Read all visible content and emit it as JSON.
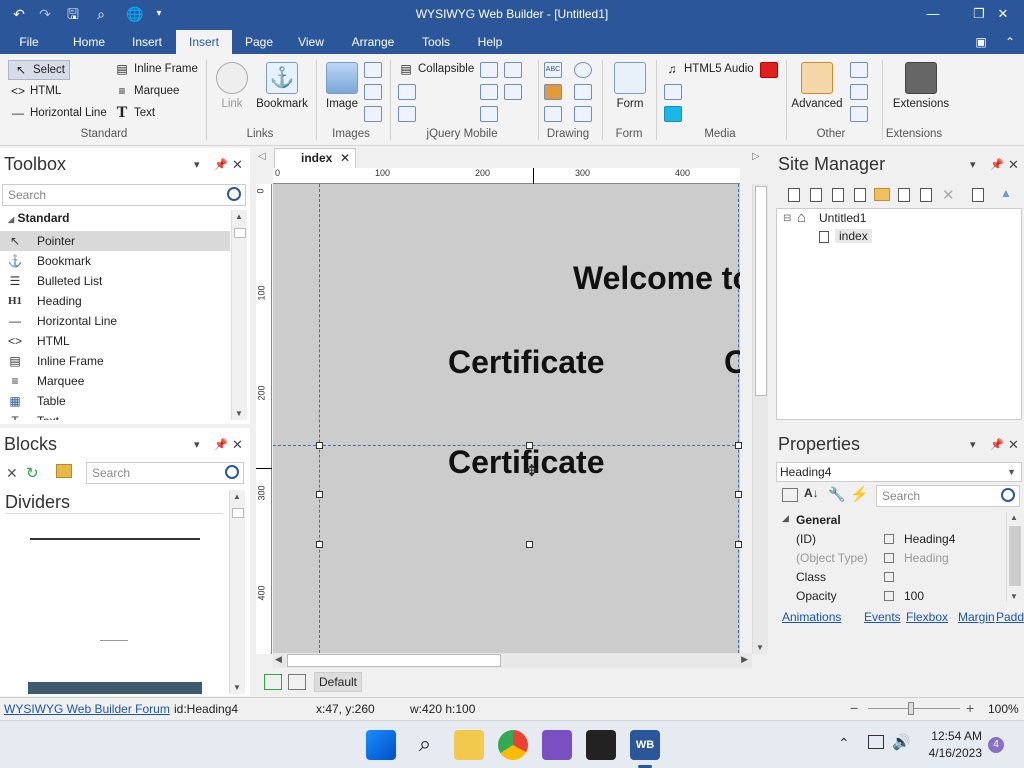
{
  "window": {
    "title": "WYSIWYG Web Builder - [Untitled1]",
    "minimize": "—",
    "restore": "❐",
    "close": "✕"
  },
  "menu_tabs": [
    "File",
    "Home",
    "Insert",
    "Insert",
    "Page",
    "View",
    "Arrange",
    "Tools",
    "Help"
  ],
  "active_tab_index": 3,
  "ribbon": {
    "standard": {
      "select": "Select",
      "html": "HTML",
      "horizontal_line": "Horizontal Line",
      "inline_frame": "Inline Frame",
      "marquee": "Marquee",
      "text": "Text",
      "label": "Standard"
    },
    "links": {
      "link": "Link",
      "bookmark": "Bookmark",
      "label": "Links"
    },
    "images": {
      "image": "Image",
      "label": "Images"
    },
    "jquery": {
      "collapsible": "Collapsible",
      "label": "jQuery Mobile"
    },
    "drawing": {
      "label": "Drawing"
    },
    "form": {
      "form": "Form",
      "label": "Form"
    },
    "media": {
      "html5_audio": "HTML5 Audio",
      "label": "Media"
    },
    "other": {
      "advanced": "Advanced",
      "label": "Other"
    },
    "extensions": {
      "extensions": "Extensions",
      "label": "Extensions"
    }
  },
  "toolbox": {
    "title": "Toolbox",
    "search_placeholder": "Search",
    "category": "Standard",
    "items": [
      {
        "label": "Pointer",
        "icon": "↖"
      },
      {
        "label": "Bookmark",
        "icon": "⚓"
      },
      {
        "label": "Bulleted List",
        "icon": "☰"
      },
      {
        "label": "Heading",
        "icon": "H1"
      },
      {
        "label": "Horizontal Line",
        "icon": "—"
      },
      {
        "label": "HTML",
        "icon": "<>"
      },
      {
        "label": "Inline Frame",
        "icon": "▤"
      },
      {
        "label": "Marquee",
        "icon": "≡"
      },
      {
        "label": "Table",
        "icon": "▦"
      },
      {
        "label": "Text",
        "icon": "T"
      }
    ]
  },
  "blocks": {
    "title": "Blocks",
    "search_placeholder": "Search",
    "section": "Dividers"
  },
  "editor": {
    "tab_label": "index",
    "ruler_top": [
      "0",
      "100",
      "200",
      "300",
      "400"
    ],
    "ruler_left": [
      "0",
      "100",
      "200",
      "300",
      "400"
    ],
    "headings": [
      "Welcome to",
      "Certificate",
      "Ce",
      "Certificate"
    ],
    "bottom_tab": "Default"
  },
  "site_manager": {
    "title": "Site Manager",
    "root": "Untitled1",
    "page": "index"
  },
  "properties": {
    "title": "Properties",
    "selected_object": "Heading4",
    "search_placeholder": "Search",
    "section": "General",
    "rows": [
      {
        "key": "(ID)",
        "value": "Heading4"
      },
      {
        "key": "(Object Type)",
        "value": "Heading"
      },
      {
        "key": "Class",
        "value": ""
      },
      {
        "key": "Opacity",
        "value": "100"
      }
    ],
    "links": [
      "Animations",
      "Events",
      "Flexbox",
      "Margin",
      "Padding"
    ]
  },
  "status": {
    "forum_link": "WYSIWYG Web Builder Forum",
    "id": "id:Heading4",
    "cursor": "x:47, y:260",
    "size": "w:420 h:100",
    "zoom": "100%"
  },
  "taskbar": {
    "time": "12:54 AM",
    "date": "4/16/2023",
    "notifications": "4"
  },
  "colors": {
    "accent": "#2b579a",
    "canvas": "#cccccc"
  }
}
